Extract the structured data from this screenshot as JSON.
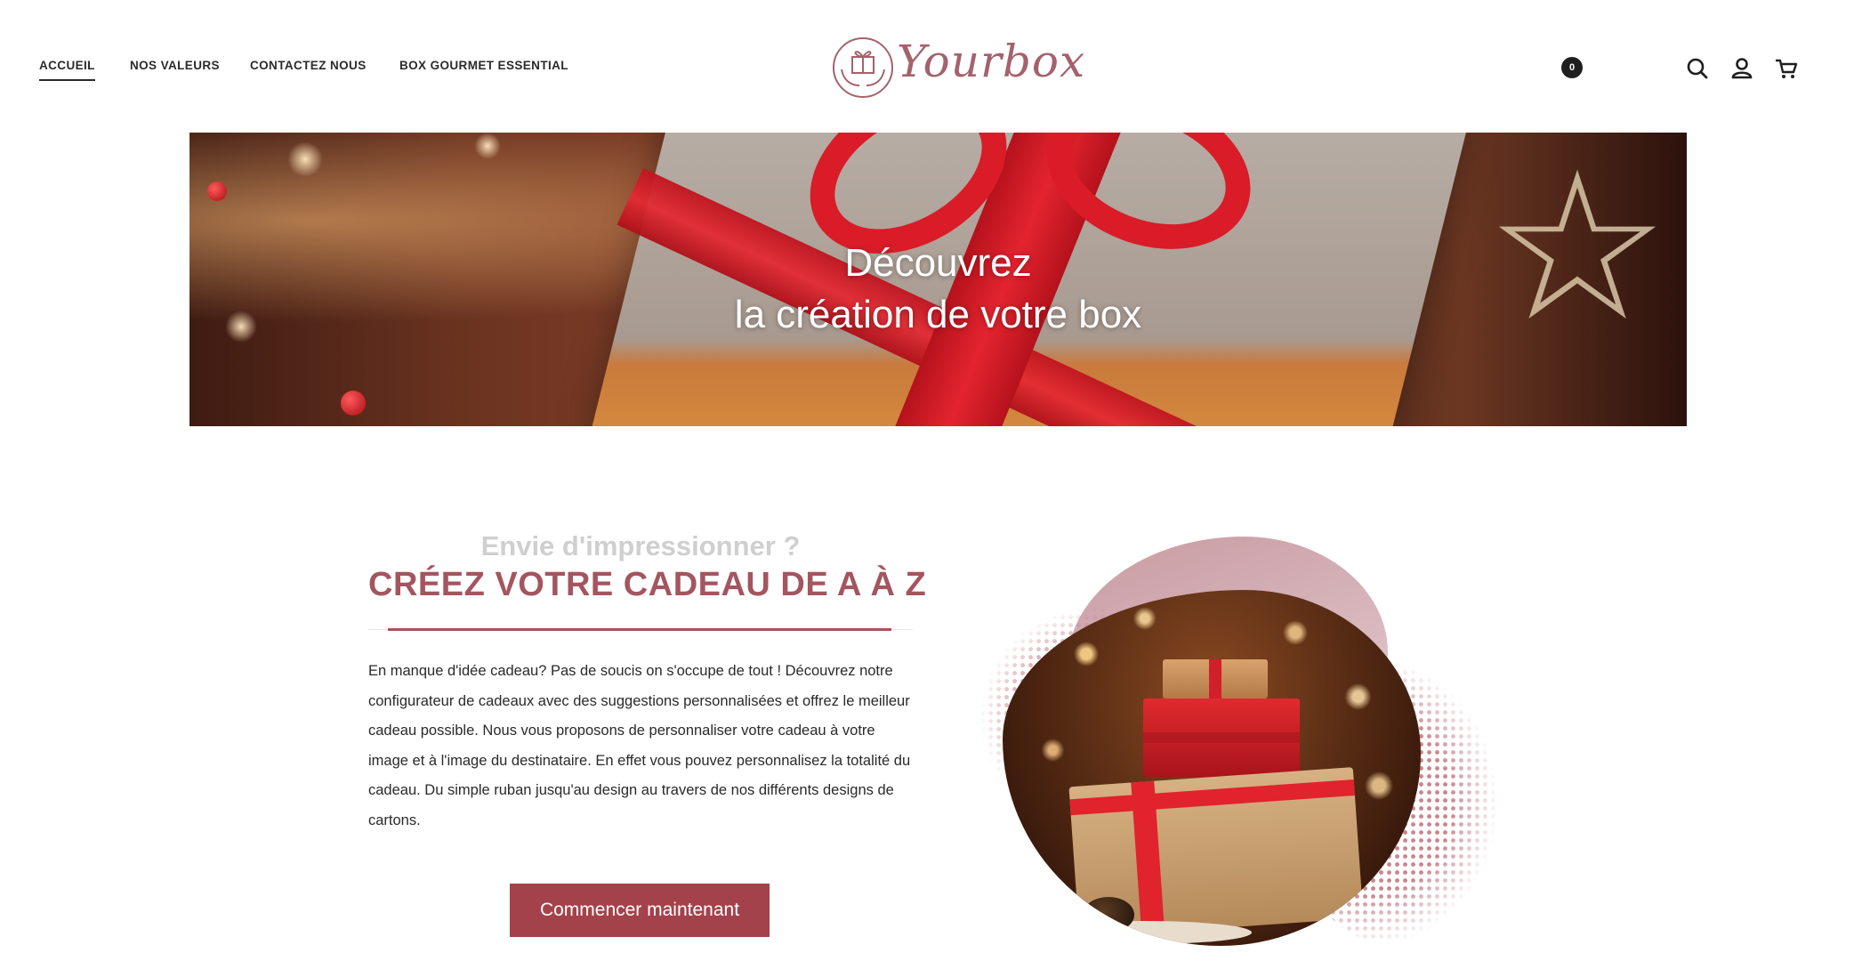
{
  "header": {
    "nav": [
      {
        "label": "ACCUEIL",
        "active": true
      },
      {
        "label": "NOS VALEURS",
        "active": false
      },
      {
        "label": "CONTACTEZ NOUS",
        "active": false
      },
      {
        "label": "BOX GOURMET ESSENTIAL",
        "active": false
      }
    ],
    "logo_text": "Yourbox",
    "icons": [
      "search-icon",
      "user-icon",
      "cart-icon"
    ],
    "cart_count": "0"
  },
  "banner": {
    "line1": "Découvrez",
    "line2": "la création de votre box"
  },
  "intro": {
    "kicker": "Envie d'impressionner ?",
    "headline": "CRÉEZ VOTRE CADEAU DE A À Z",
    "description": "En manque d'idée cadeau? Pas de soucis on s'occupe de tout ! Découvrez notre configurateur de cadeaux avec des suggestions personnalisées et offrez le meilleur cadeau possible. Nous vous proposons de personnaliser votre cadeau à votre image et à l'image du destinataire. En effet vous pouvez personnalisez la totalité du cadeau. Du simple ruban jusqu'au design au travers de nos différents designs de cartons.",
    "cta_label": "Commencer maintenant"
  },
  "colors": {
    "accent": "#a4424b",
    "headline": "#a4555f",
    "kicker": "#cfcfcf",
    "logo": "#a4626c"
  }
}
